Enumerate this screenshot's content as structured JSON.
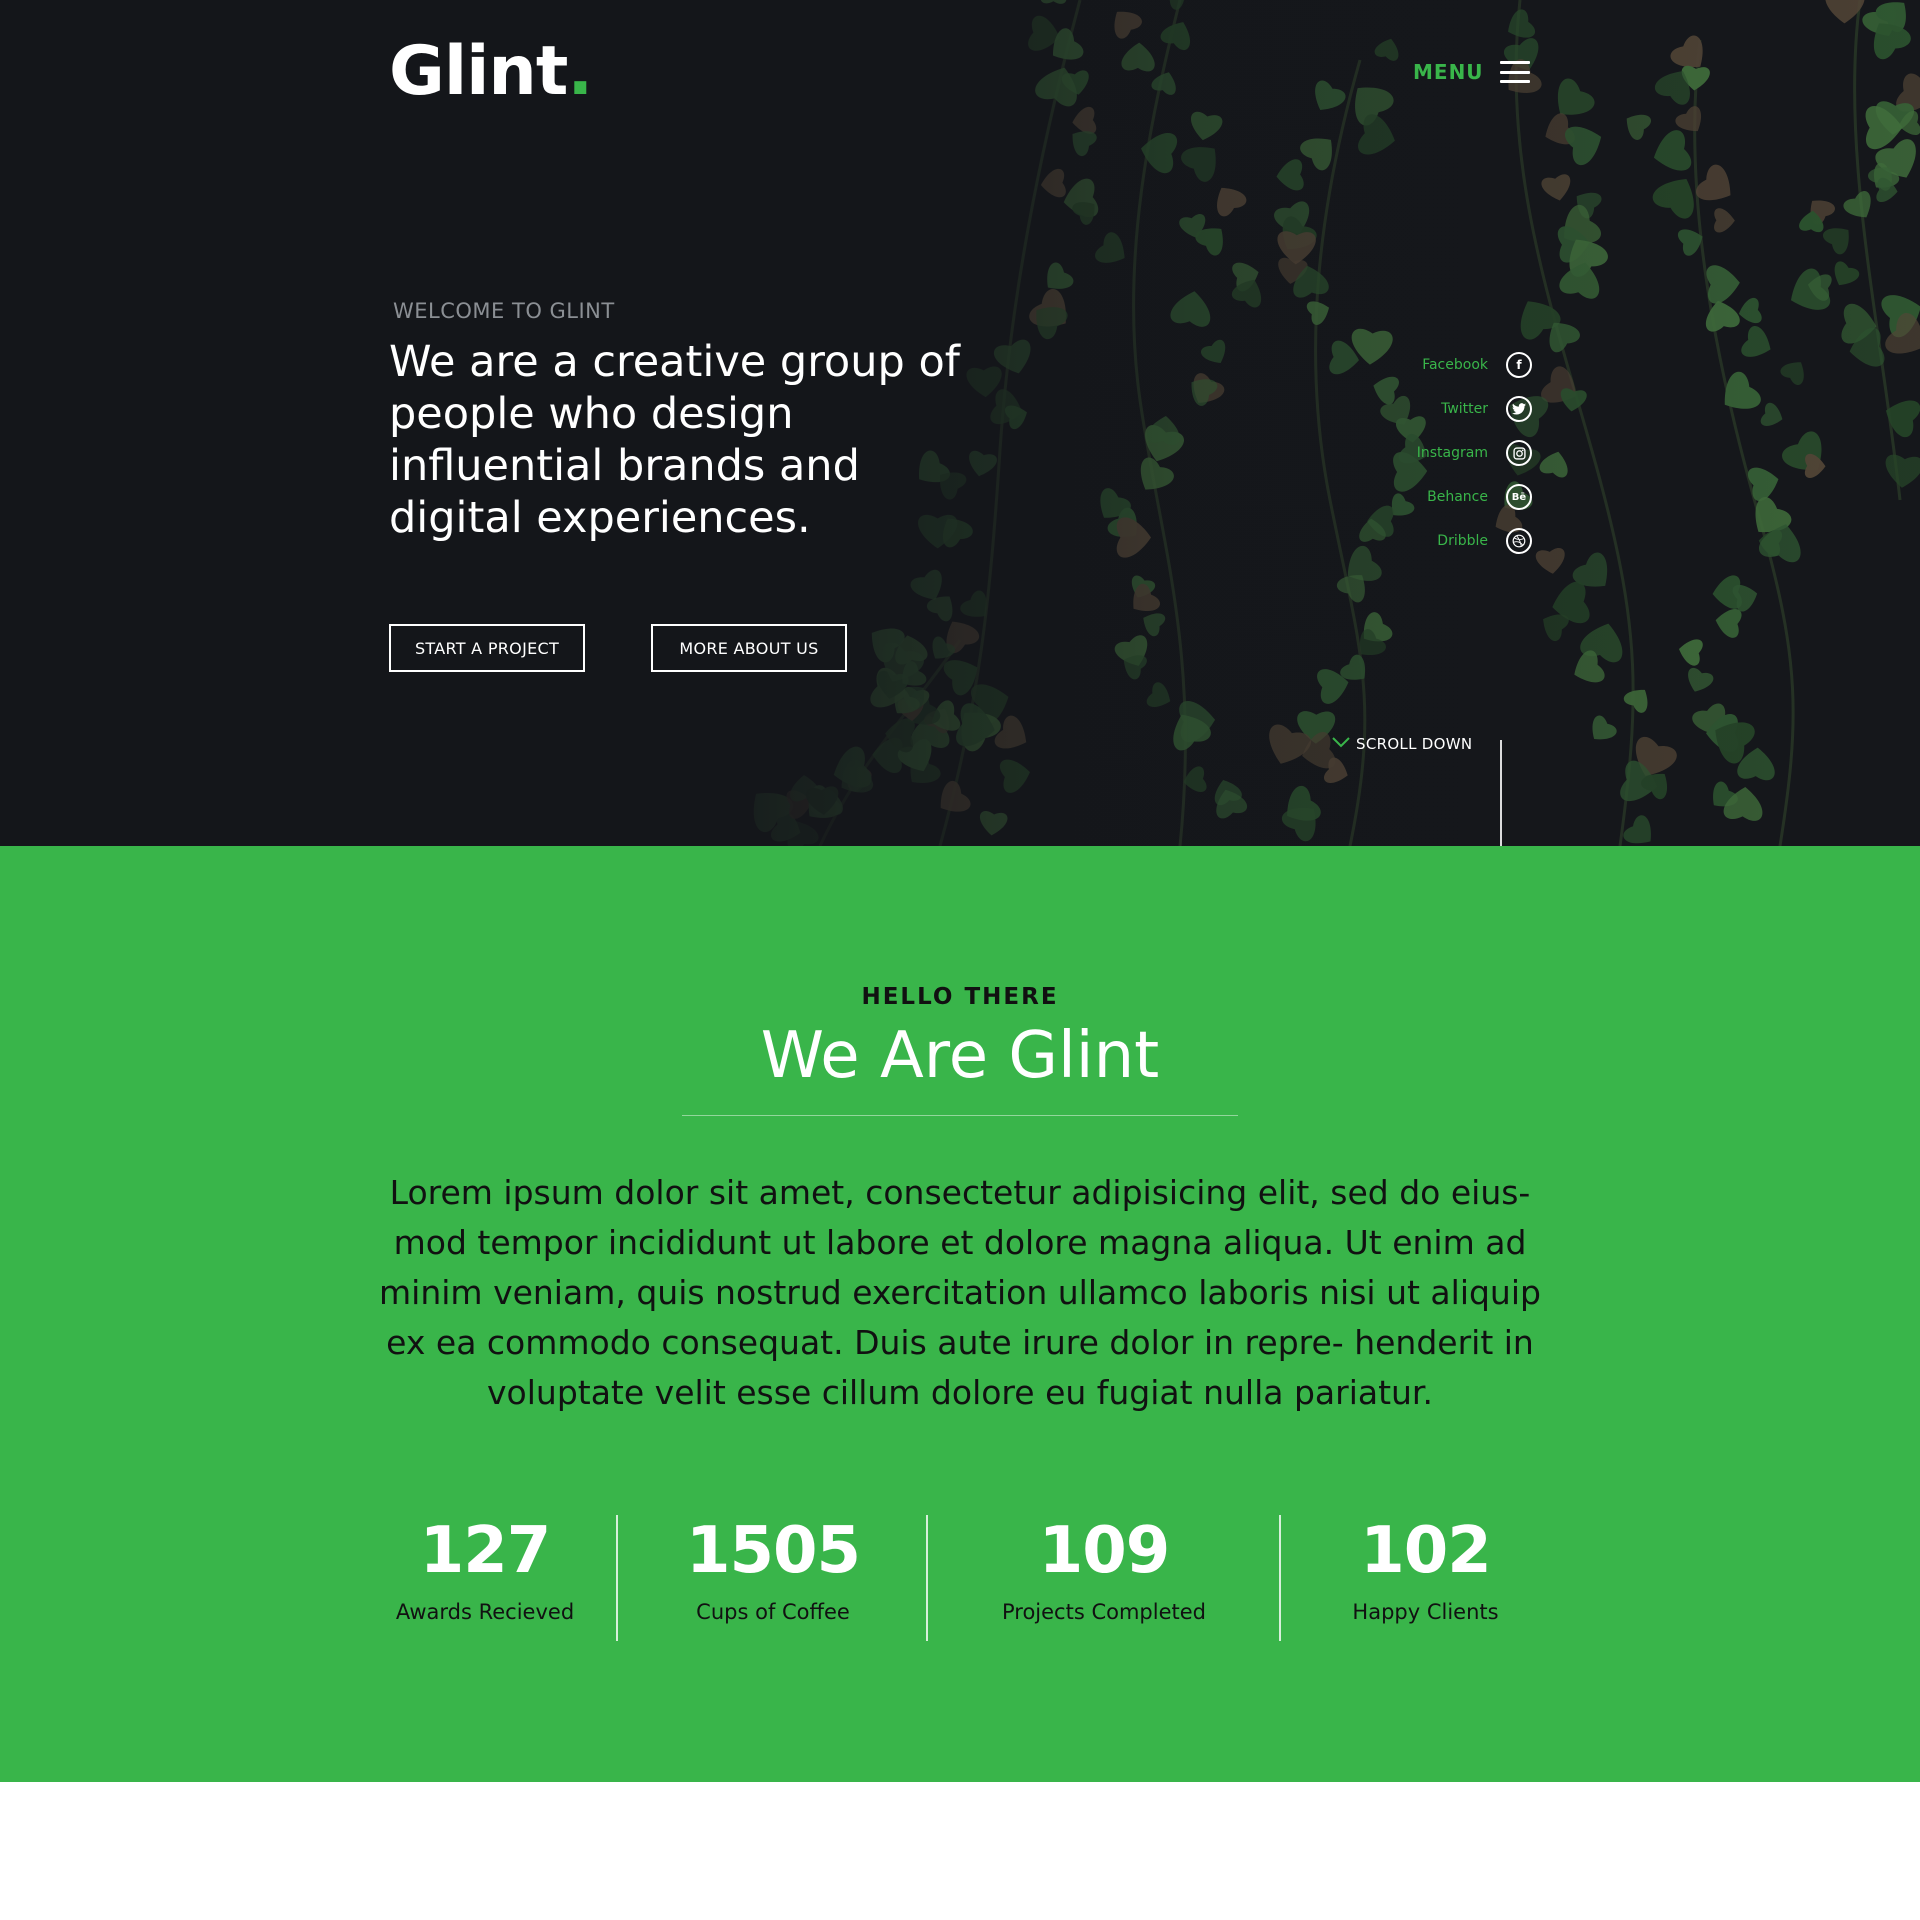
{
  "header": {
    "logo_text": "Glint",
    "logo_dot": ".",
    "menu_label": "MENU"
  },
  "hero": {
    "eyebrow": "WELCOME TO GLINT",
    "title": "We are a creative group of people who design influential brands and digital experiences.",
    "buttons": {
      "start": "START A PROJECT",
      "more": "MORE ABOUT US"
    },
    "social": [
      {
        "label": "Facebook",
        "icon": "facebook-icon",
        "glyph": "f"
      },
      {
        "label": "Twitter",
        "icon": "twitter-icon",
        "glyph": "t"
      },
      {
        "label": "Instagram",
        "icon": "instagram-icon",
        "glyph": "◎"
      },
      {
        "label": "Behance",
        "icon": "behance-icon",
        "glyph": "Bē"
      },
      {
        "label": "Dribble",
        "icon": "dribbble-icon",
        "glyph": "❂"
      }
    ],
    "scroll_label": "SCROLL DOWN"
  },
  "about": {
    "eyebrow": "HELLO THERE",
    "title": "We Are Glint",
    "text": "Lorem ipsum dolor sit amet, consectetur adipisicing elit, sed do eius- mod tempor incididunt ut labore et dolore magna aliqua. Ut enim ad minim veniam, quis nostrud exercitation ullamco laboris nisi ut aliquip ex ea commodo consequat. Duis aute irure dolor in repre- henderit in voluptate velit esse cillum dolore eu fugiat nulla pariatur.",
    "stats": [
      {
        "value": "127",
        "label": "Awards Recieved"
      },
      {
        "value": "1505",
        "label": "Cups of Coffee"
      },
      {
        "value": "109",
        "label": "Projects Completed"
      },
      {
        "value": "102",
        "label": "Happy Clients"
      }
    ]
  },
  "colors": {
    "accent": "#39b54a",
    "hero_bg": "#14161a",
    "text_dark": "#111111",
    "white": "#ffffff"
  }
}
